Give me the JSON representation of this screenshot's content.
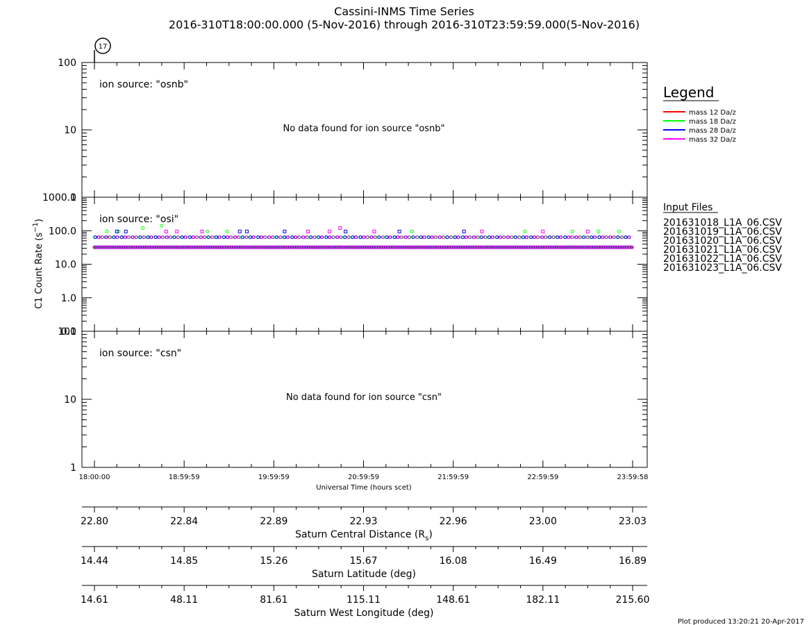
{
  "title_line1": "Cassini-INMS Time Series",
  "title_line2": "2016-310T18:00:00.000 (5-Nov-2016) through 2016-310T23:59:59.000(5-Nov-2016)",
  "marker_label": "17",
  "legend": {
    "heading": "Legend",
    "entries": [
      {
        "label": "mass 12 Da/z",
        "color": "#ff0000"
      },
      {
        "label": "mass 18 Da/z",
        "color": "#00ff00"
      },
      {
        "label": "mass 28 Da/z",
        "color": "#0000ff"
      },
      {
        "label": "mass 32 Da/z",
        "color": "#ff00ff"
      }
    ]
  },
  "input_files": {
    "heading": "Input Files",
    "files": [
      "201631018_L1A_06.CSV",
      "201631019_L1A_06.CSV",
      "201631020_L1A_06.CSV",
      "201631021_L1A_06.CSV",
      "201631022_L1A_06.CSV",
      "201631023_L1A_06.CSV"
    ]
  },
  "footer": "Plot produced 13:20:21 20-Apr-2017",
  "chart_data": {
    "type": "scatter",
    "x_axis": {
      "label": "Universal Time (hours scet)",
      "range": [
        "18:00:00",
        "23:59:58"
      ],
      "tick_labels": [
        "18:00:00",
        "18:59:59",
        "19:59:59",
        "20:59:59",
        "21:59:59",
        "22:59:59",
        "23:59:58"
      ]
    },
    "y_axis_label": "C1 Count Rate (s⁻¹)",
    "y_scale": "log",
    "panels": [
      {
        "label": "ion source: \"osnb\"",
        "ylim": [
          1,
          100
        ],
        "tick_labels": [
          "1",
          "10",
          "100"
        ],
        "message": "No data found for ion source \"osnb\"",
        "series": []
      },
      {
        "label": "ion source: \"osi\"",
        "ylim": [
          0.1,
          1000
        ],
        "tick_labels": [
          "0.1",
          "1.0",
          "10.0",
          "100.0",
          "1000.0"
        ],
        "message": "",
        "series": [
          {
            "mass": "mass 12 Da/z",
            "color": "#ff0000",
            "baseline": 32,
            "secondary": 0,
            "outliers": []
          },
          {
            "mass": "mass 18 Da/z",
            "color": "#00ff00",
            "baseline": 32,
            "secondary": 64,
            "outliers": [
              [
                0.14,
                95
              ],
              [
                0.27,
                95
              ],
              [
                0.54,
                120
              ],
              [
                0.75,
                140
              ],
              [
                1.26,
                95
              ],
              [
                1.48,
                95
              ],
              [
                3.54,
                95
              ],
              [
                4.8,
                95
              ],
              [
                5.33,
                95
              ],
              [
                5.62,
                95
              ],
              [
                5.85,
                95
              ]
            ]
          },
          {
            "mass": "mass 28 Da/z",
            "color": "#0000ff",
            "baseline": 32,
            "secondary": 64,
            "outliers": [
              [
                0.25,
                95
              ],
              [
                0.35,
                95
              ],
              [
                1.62,
                95
              ],
              [
                1.7,
                95
              ],
              [
                2.12,
                95
              ],
              [
                2.8,
                95
              ],
              [
                3.4,
                95
              ],
              [
                4.12,
                95
              ]
            ]
          },
          {
            "mass": "mass 32 Da/z",
            "color": "#ff00ff",
            "baseline": 32,
            "secondary": 64,
            "outliers": [
              [
                0.8,
                95
              ],
              [
                0.92,
                95
              ],
              [
                1.2,
                95
              ],
              [
                2.38,
                95
              ],
              [
                2.62,
                95
              ],
              [
                2.74,
                120
              ],
              [
                3.12,
                95
              ],
              [
                4.32,
                95
              ],
              [
                5.0,
                95
              ],
              [
                5.5,
                95
              ]
            ]
          }
        ]
      },
      {
        "label": "ion source: \"csn\"",
        "ylim": [
          1,
          100
        ],
        "tick_labels": [
          "1",
          "10",
          "100"
        ],
        "message": "No data found for ion source \"csn\"",
        "series": []
      }
    ],
    "aux_axes": [
      {
        "label": "Saturn Central Distance (R",
        "subscript": "s",
        "suffix": ")",
        "values": [
          "22.80",
          "22.84",
          "22.89",
          "22.93",
          "22.96",
          "23.00",
          "23.03"
        ]
      },
      {
        "label": "Saturn Latitude (deg)",
        "subscript": "",
        "suffix": "",
        "values": [
          "14.44",
          "14.85",
          "15.26",
          "15.67",
          "16.08",
          "16.49",
          "16.89"
        ]
      },
      {
        "label": "Saturn West Longitude (deg)",
        "subscript": "",
        "suffix": "",
        "values": [
          "14.61",
          "48.11",
          "81.61",
          "115.11",
          "148.61",
          "182.11",
          "215.60"
        ]
      }
    ]
  }
}
